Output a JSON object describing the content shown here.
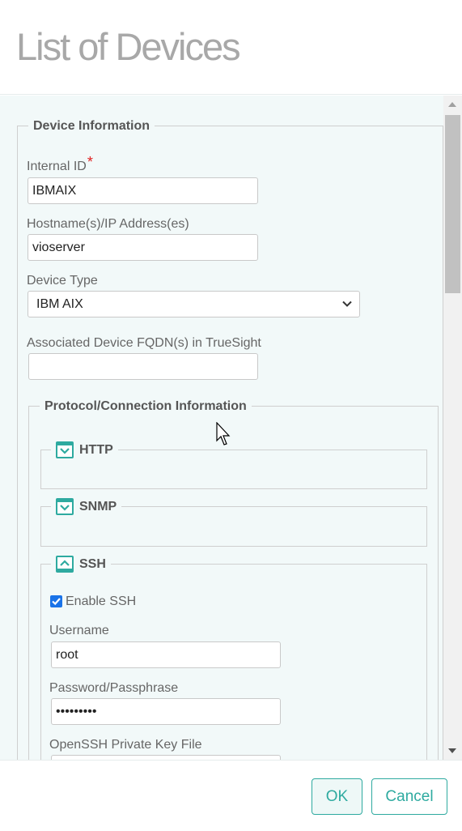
{
  "header": {
    "title": "List of Devices"
  },
  "device_info": {
    "legend": "Device Information",
    "internal_id": {
      "label": "Internal ID",
      "required_mark": "*",
      "value": "IBMAIX"
    },
    "hostname": {
      "label": "Hostname(s)/IP Address(es)",
      "value": "vioserver"
    },
    "device_type": {
      "label": "Device Type",
      "value": "IBM AIX"
    },
    "fqdn": {
      "label": "Associated Device FQDN(s) in TrueSight",
      "value": ""
    }
  },
  "protocol": {
    "legend": "Protocol/Connection Information",
    "sections": [
      {
        "label": "HTTP",
        "state": "collapsed"
      },
      {
        "label": "SNMP",
        "state": "collapsed"
      },
      {
        "label": "SSH",
        "state": "expanded"
      }
    ],
    "ssh": {
      "enable_label": "Enable SSH",
      "enable_checked": true,
      "username": {
        "label": "Username",
        "value": "root"
      },
      "password": {
        "label": "Password/Passphrase",
        "value": "•••••••••"
      },
      "key_file": {
        "label": "OpenSSH Private Key File"
      }
    }
  },
  "footer": {
    "ok_label": "OK",
    "cancel_label": "Cancel"
  },
  "colors": {
    "accent": "#2eaaa0",
    "background": "#f2f9f9",
    "checkbox": "#1a73e8",
    "required": "#e02020"
  }
}
